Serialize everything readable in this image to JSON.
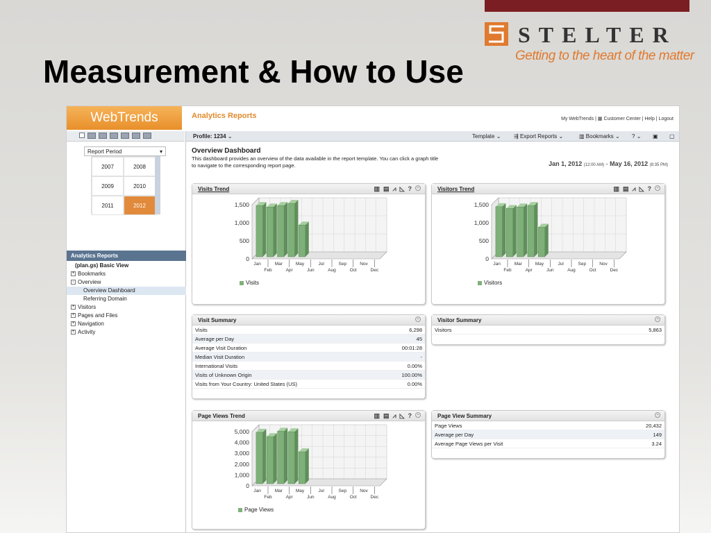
{
  "brand": {
    "name": "STELTER",
    "tagline": "Getting to the heart of the matter",
    "accent": "#7b1e23",
    "logo_orange": "#e07a2f"
  },
  "slide_title": "Measurement & How to Use",
  "app": {
    "logo_text": "WebTrends",
    "title": "Analytics Reports",
    "links": [
      "My WebTrends",
      "Customer Center",
      "Help",
      "Logout"
    ]
  },
  "toolbar": {
    "profile_label": "Profile: 1234",
    "template_label": "Template",
    "export_label": "Export Reports",
    "bookmarks_label": "Bookmarks",
    "help_label": "?"
  },
  "sidebar": {
    "period_label": "Report Period",
    "years": [
      "2007",
      "2008",
      "2009",
      "2010",
      "2011",
      "2012"
    ],
    "selected_year": "2012",
    "nav_header": "Analytics Reports",
    "nav_items": [
      {
        "label": "(plan.gs) Basic View",
        "level": 1,
        "toggle": ""
      },
      {
        "label": "Bookmarks",
        "level": 0,
        "toggle": "+"
      },
      {
        "label": "Overview",
        "level": 0,
        "toggle": "-"
      },
      {
        "label": "Overview Dashboard",
        "level": 2,
        "toggle": "",
        "active": true
      },
      {
        "label": "Referring Domain",
        "level": 2,
        "toggle": ""
      },
      {
        "label": "Visitors",
        "level": 0,
        "toggle": "+"
      },
      {
        "label": "Pages and Files",
        "level": 0,
        "toggle": "+"
      },
      {
        "label": "Navigation",
        "level": 0,
        "toggle": "+"
      },
      {
        "label": "Activity",
        "level": 0,
        "toggle": "+"
      }
    ]
  },
  "dashboard": {
    "title": "Overview Dashboard",
    "description": "This dashboard provides an overview of the data available in the report template. You can click a graph title to navigate to the corresponding report page.",
    "date_start": "Jan 1, 2012",
    "date_start_time": "(12:00 AM)",
    "date_end": "May 16, 2012",
    "date_end_time": "(8:35 PM)"
  },
  "months_top": [
    "Jan",
    "Mar",
    "May",
    "Jul",
    "Sep",
    "Nov"
  ],
  "months_bottom": [
    "Feb",
    "Apr",
    "Jun",
    "Aug",
    "Oct",
    "Dec"
  ],
  "chart_data": [
    {
      "type": "bar",
      "title": "Visits Trend",
      "categories": [
        "Jan",
        "Feb",
        "Mar",
        "Apr",
        "May",
        "Jun",
        "Jul",
        "Aug",
        "Sep",
        "Oct",
        "Nov",
        "Dec"
      ],
      "series": [
        {
          "name": "Visits",
          "values": [
            1420,
            1380,
            1420,
            1480,
            880,
            0,
            0,
            0,
            0,
            0,
            0,
            0
          ]
        }
      ],
      "yticks": [
        "1,500",
        "1,000",
        "500",
        "0"
      ],
      "ylim": [
        0,
        1500
      ],
      "bar_color": "#7fb07a"
    },
    {
      "type": "bar",
      "title": "Visitors Trend",
      "categories": [
        "Jan",
        "Feb",
        "Mar",
        "Apr",
        "May",
        "Jun",
        "Jul",
        "Aug",
        "Sep",
        "Oct",
        "Nov",
        "Dec"
      ],
      "series": [
        {
          "name": "Visitors",
          "values": [
            1390,
            1340,
            1380,
            1420,
            820,
            0,
            0,
            0,
            0,
            0,
            0,
            0
          ]
        }
      ],
      "yticks": [
        "1,500",
        "1,000",
        "500",
        "0"
      ],
      "ylim": [
        0,
        1500
      ],
      "bar_color": "#7fb07a"
    },
    {
      "type": "bar",
      "title": "Page Views Trend",
      "categories": [
        "Jan",
        "Feb",
        "Mar",
        "Apr",
        "May",
        "Jun",
        "Jul",
        "Aug",
        "Sep",
        "Oct",
        "Nov",
        "Dec"
      ],
      "series": [
        {
          "name": "Page Views",
          "values": [
            4750,
            4350,
            4850,
            4800,
            2950,
            0,
            0,
            0,
            0,
            0,
            0,
            0
          ]
        }
      ],
      "yticks": [
        "5,000",
        "4,000",
        "3,000",
        "2,000",
        "1,000",
        "0"
      ],
      "ylim": [
        0,
        5000
      ],
      "bar_color": "#7fb07a"
    }
  ],
  "visit_summary": {
    "title": "Visit Summary",
    "rows": [
      {
        "label": "Visits",
        "value": "6,298"
      },
      {
        "label": "Average per Day",
        "value": "45"
      },
      {
        "label": "Average Visit Duration",
        "value": "00:01:28"
      },
      {
        "label": "Median Visit Duration",
        "value": "-"
      },
      {
        "label": "International Visits",
        "value": "0.00%"
      },
      {
        "label": "Visits of Unknown Origin",
        "value": "100.00%"
      },
      {
        "label": "Visits from Your Country: United States (US)",
        "value": "0.00%"
      }
    ]
  },
  "visitor_summary": {
    "title": "Visitor Summary",
    "rows": [
      {
        "label": "Visitors",
        "value": "5,863"
      }
    ]
  },
  "page_view_summary": {
    "title": "Page View Summary",
    "rows": [
      {
        "label": "Page Views",
        "value": "20,432"
      },
      {
        "label": "Average per Day",
        "value": "149"
      },
      {
        "label": "Average Page Views per Visit",
        "value": "3.24"
      }
    ]
  }
}
